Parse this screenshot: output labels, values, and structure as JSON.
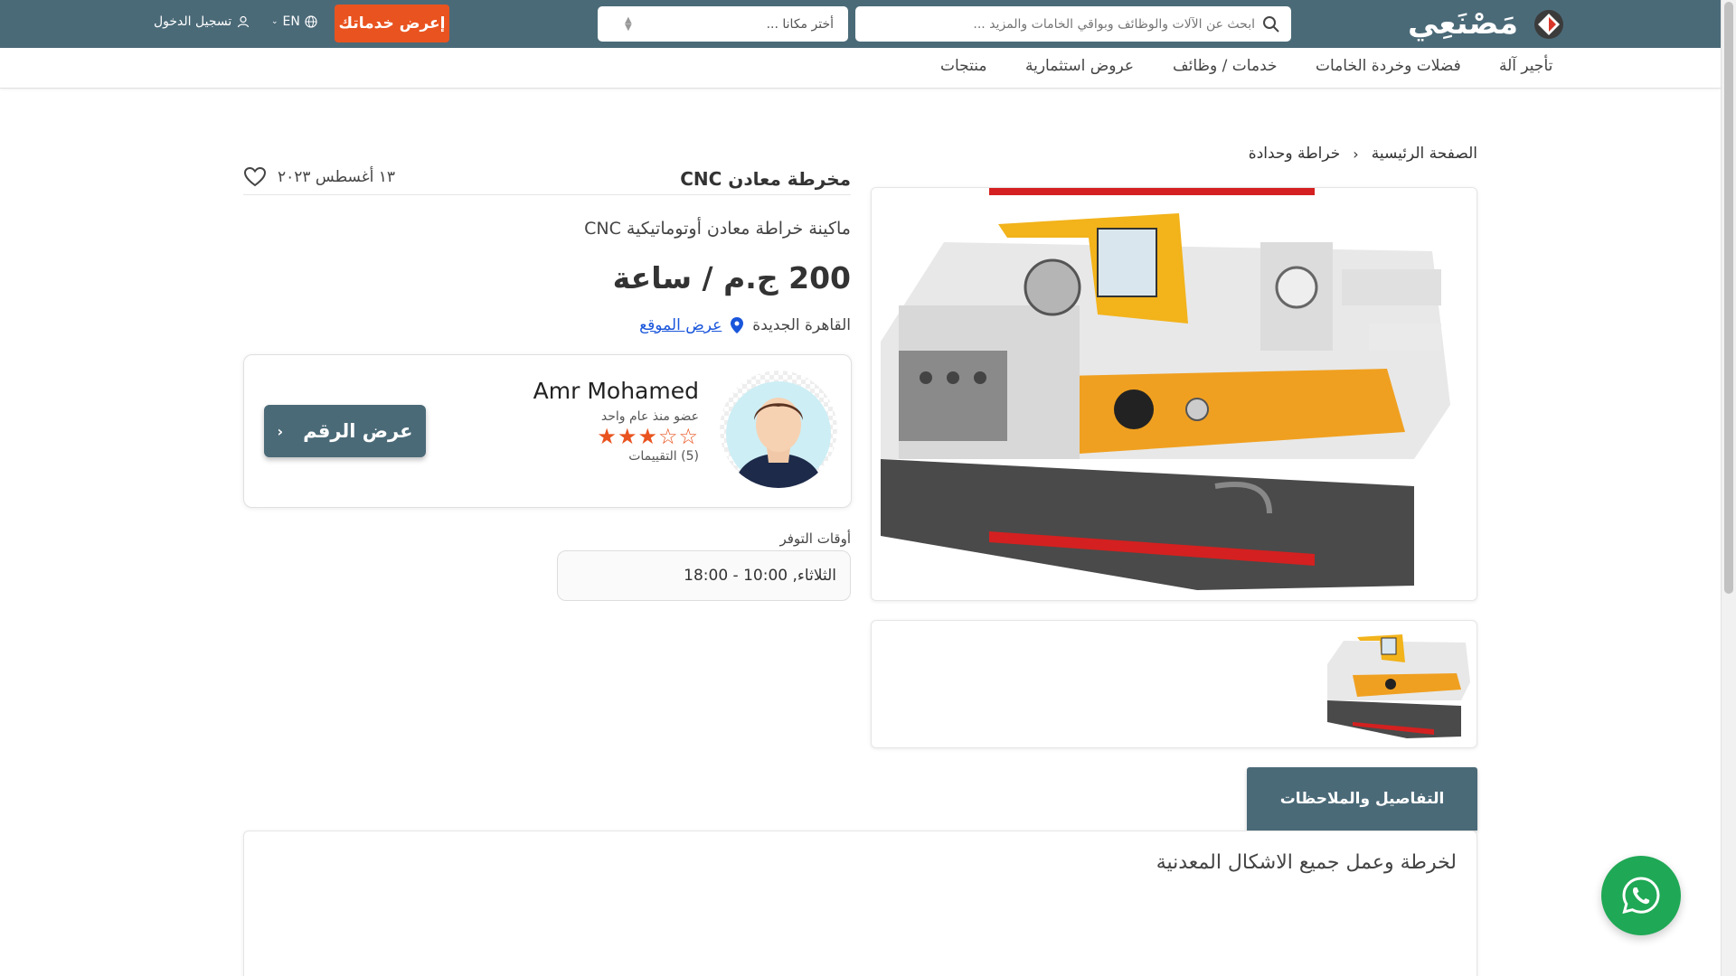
{
  "header": {
    "logo_text": "مَصْنَعِي",
    "search_placeholder": "ابحث عن الآلات والوظائف وبواقي الخامات والمزيد ...",
    "location_placeholder": "أختر مكانا ...",
    "offer_button": "إعرض خدماتك",
    "language": "EN",
    "login": "تسجيل الدخول",
    "brand_color": "#4b6a78",
    "accent_color": "#e9531f"
  },
  "nav": {
    "items": [
      "تأجير آلة",
      "فضلات وخردة الخامات",
      "خدمات / وظائف",
      "عروض استثمارية",
      "منتجات"
    ]
  },
  "breadcrumb": {
    "home": "الصفحة الرئيسية",
    "category": "خراطة وحدادة"
  },
  "listing": {
    "title": "مخرطة معادن CNC",
    "date": "١٣ أغسطس ٢٠٢٣",
    "subtitle": "ماكينة خراطة معادن أوتوماتيكية CNC",
    "price": "200 ج.م / ساعة",
    "city": "القاهرة الجديدة",
    "map_link": "عرض الموقع"
  },
  "seller": {
    "name": "Amr Mohamed",
    "member_since": "عضو منذ عام واحد",
    "stars": "★★★☆☆",
    "rating_value": 3,
    "rating_max": 5,
    "ratings_count": "(5) التقييمات",
    "phone_button": "عرض الرقم"
  },
  "availability": {
    "label": "أوقات التوفر",
    "value": "الثلاثاء, 10:00 - 18:00"
  },
  "details": {
    "tab_label": "التفاصيل والملاحظات",
    "text": "لخرطة وعمل جميع الاشكال المعدنية"
  },
  "icons": {
    "search": "search-icon",
    "globe": "globe-icon",
    "user": "user-icon",
    "heart": "heart-icon",
    "location": "location-pin-icon",
    "whatsapp": "whatsapp-icon"
  }
}
